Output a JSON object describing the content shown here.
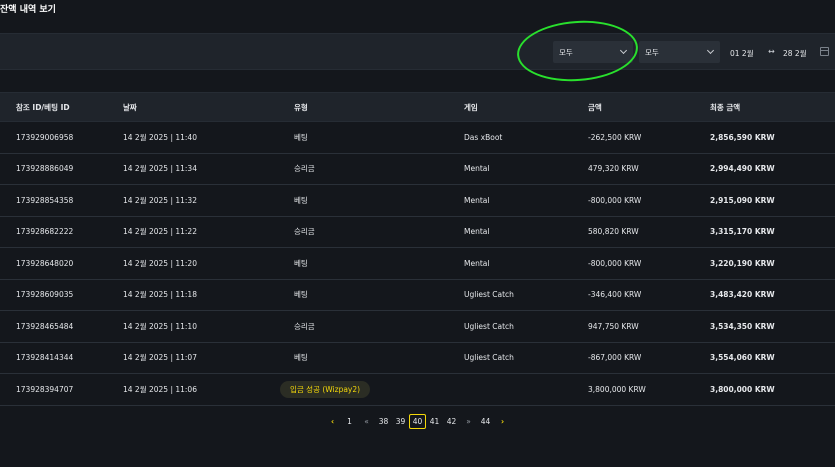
{
  "page": {
    "title": "잔액 내역 보기"
  },
  "filters": {
    "type_value": "모두",
    "game_value": "모두",
    "date_from": "01 2월",
    "date_arrow": "↔",
    "date_to": "28 2월"
  },
  "table": {
    "headers": [
      "참조 ID/베팅 ID",
      "날짜",
      "유형",
      "게임",
      "금액",
      "최종 금액"
    ],
    "rows": [
      {
        "id": "173929006958",
        "date": "14 2월 2025 | 11:40",
        "type": "베팅",
        "game": "Das xBoot",
        "amount": "-262,500 KRW",
        "final": "2,856,590 KRW"
      },
      {
        "id": "173928886049",
        "date": "14 2월 2025 | 11:34",
        "type": "승리금",
        "game": "Mental",
        "amount": "479,320 KRW",
        "final": "2,994,490 KRW"
      },
      {
        "id": "173928854358",
        "date": "14 2월 2025 | 11:32",
        "type": "베팅",
        "game": "Mental",
        "amount": "-800,000 KRW",
        "final": "2,915,090 KRW"
      },
      {
        "id": "173928682222",
        "date": "14 2월 2025 | 11:22",
        "type": "승리금",
        "game": "Mental",
        "amount": "580,820 KRW",
        "final": "3,315,170 KRW"
      },
      {
        "id": "173928648020",
        "date": "14 2월 2025 | 11:20",
        "type": "베팅",
        "game": "Mental",
        "amount": "-800,000 KRW",
        "final": "3,220,190 KRW"
      },
      {
        "id": "173928609035",
        "date": "14 2월 2025 | 11:18",
        "type": "베팅",
        "game": "Ugliest Catch",
        "amount": "-346,400 KRW",
        "final": "3,483,420 KRW"
      },
      {
        "id": "173928465484",
        "date": "14 2월 2025 | 11:10",
        "type": "승리금",
        "game": "Ugliest Catch",
        "amount": "947,750 KRW",
        "final": "3,534,350 KRW"
      },
      {
        "id": "173928414344",
        "date": "14 2월 2025 | 11:07",
        "type": "베팅",
        "game": "Ugliest Catch",
        "amount": "-867,000 KRW",
        "final": "3,554,060 KRW"
      },
      {
        "id": "173928394707",
        "date": "14 2월 2025 | 11:06",
        "type": "입금 성공 (Wizpay2)",
        "game": "",
        "amount": "3,800,000 KRW",
        "final": "3,800,000 KRW"
      }
    ]
  },
  "pagination": {
    "prev": "‹",
    "first": "1",
    "jump_back": "«",
    "pages_before": [
      "38",
      "39"
    ],
    "current": "40",
    "pages_after": [
      "41",
      "42"
    ],
    "jump_forward": "»",
    "last": "44",
    "next": "›"
  },
  "colors": {
    "accent": "#f5d90a",
    "annotation": "#29e02d",
    "background": "#14171c"
  }
}
